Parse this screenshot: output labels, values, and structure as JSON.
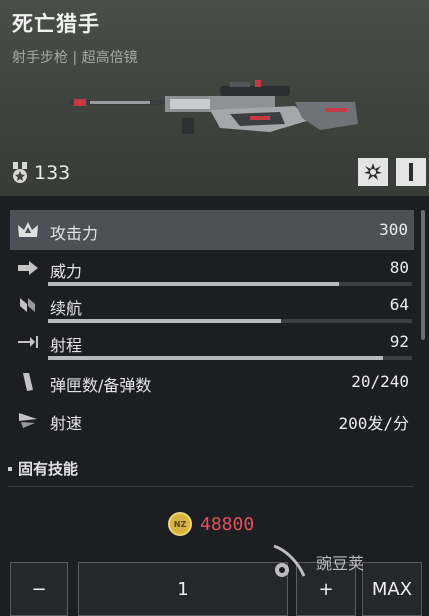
{
  "weapon": {
    "name": "死亡猎手",
    "subtitle": "射手步枪 | 超高倍镜",
    "rating": "133"
  },
  "stats": [
    {
      "label": "攻击力",
      "value": "300",
      "icon": "crown-icon",
      "highlight": true
    },
    {
      "label": "威力",
      "value": "80",
      "icon": "arrow-right-icon",
      "bar": 0.8
    },
    {
      "label": "续航",
      "value": "64",
      "icon": "wings-icon",
      "bar": 0.64
    },
    {
      "label": "射程",
      "value": "92",
      "icon": "range-arrow-icon",
      "bar": 0.92
    },
    {
      "label": "弹匣数/备弹数",
      "value": "20/240",
      "icon": "magazine-icon"
    },
    {
      "label": "射速",
      "value": "200发/分",
      "icon": "fire-rate-icon"
    }
  ],
  "skills": {
    "title": "固有技能"
  },
  "purchase": {
    "currency": "NZ",
    "price": "48800",
    "quantity": "1",
    "minus_label": "−",
    "plus_label": "+",
    "max_label": "MAX"
  },
  "watermark": {
    "text": "豌豆荚"
  },
  "colors": {
    "price": "#e0525b",
    "coin": "#d9b343",
    "accent_red": "#c8323c"
  }
}
